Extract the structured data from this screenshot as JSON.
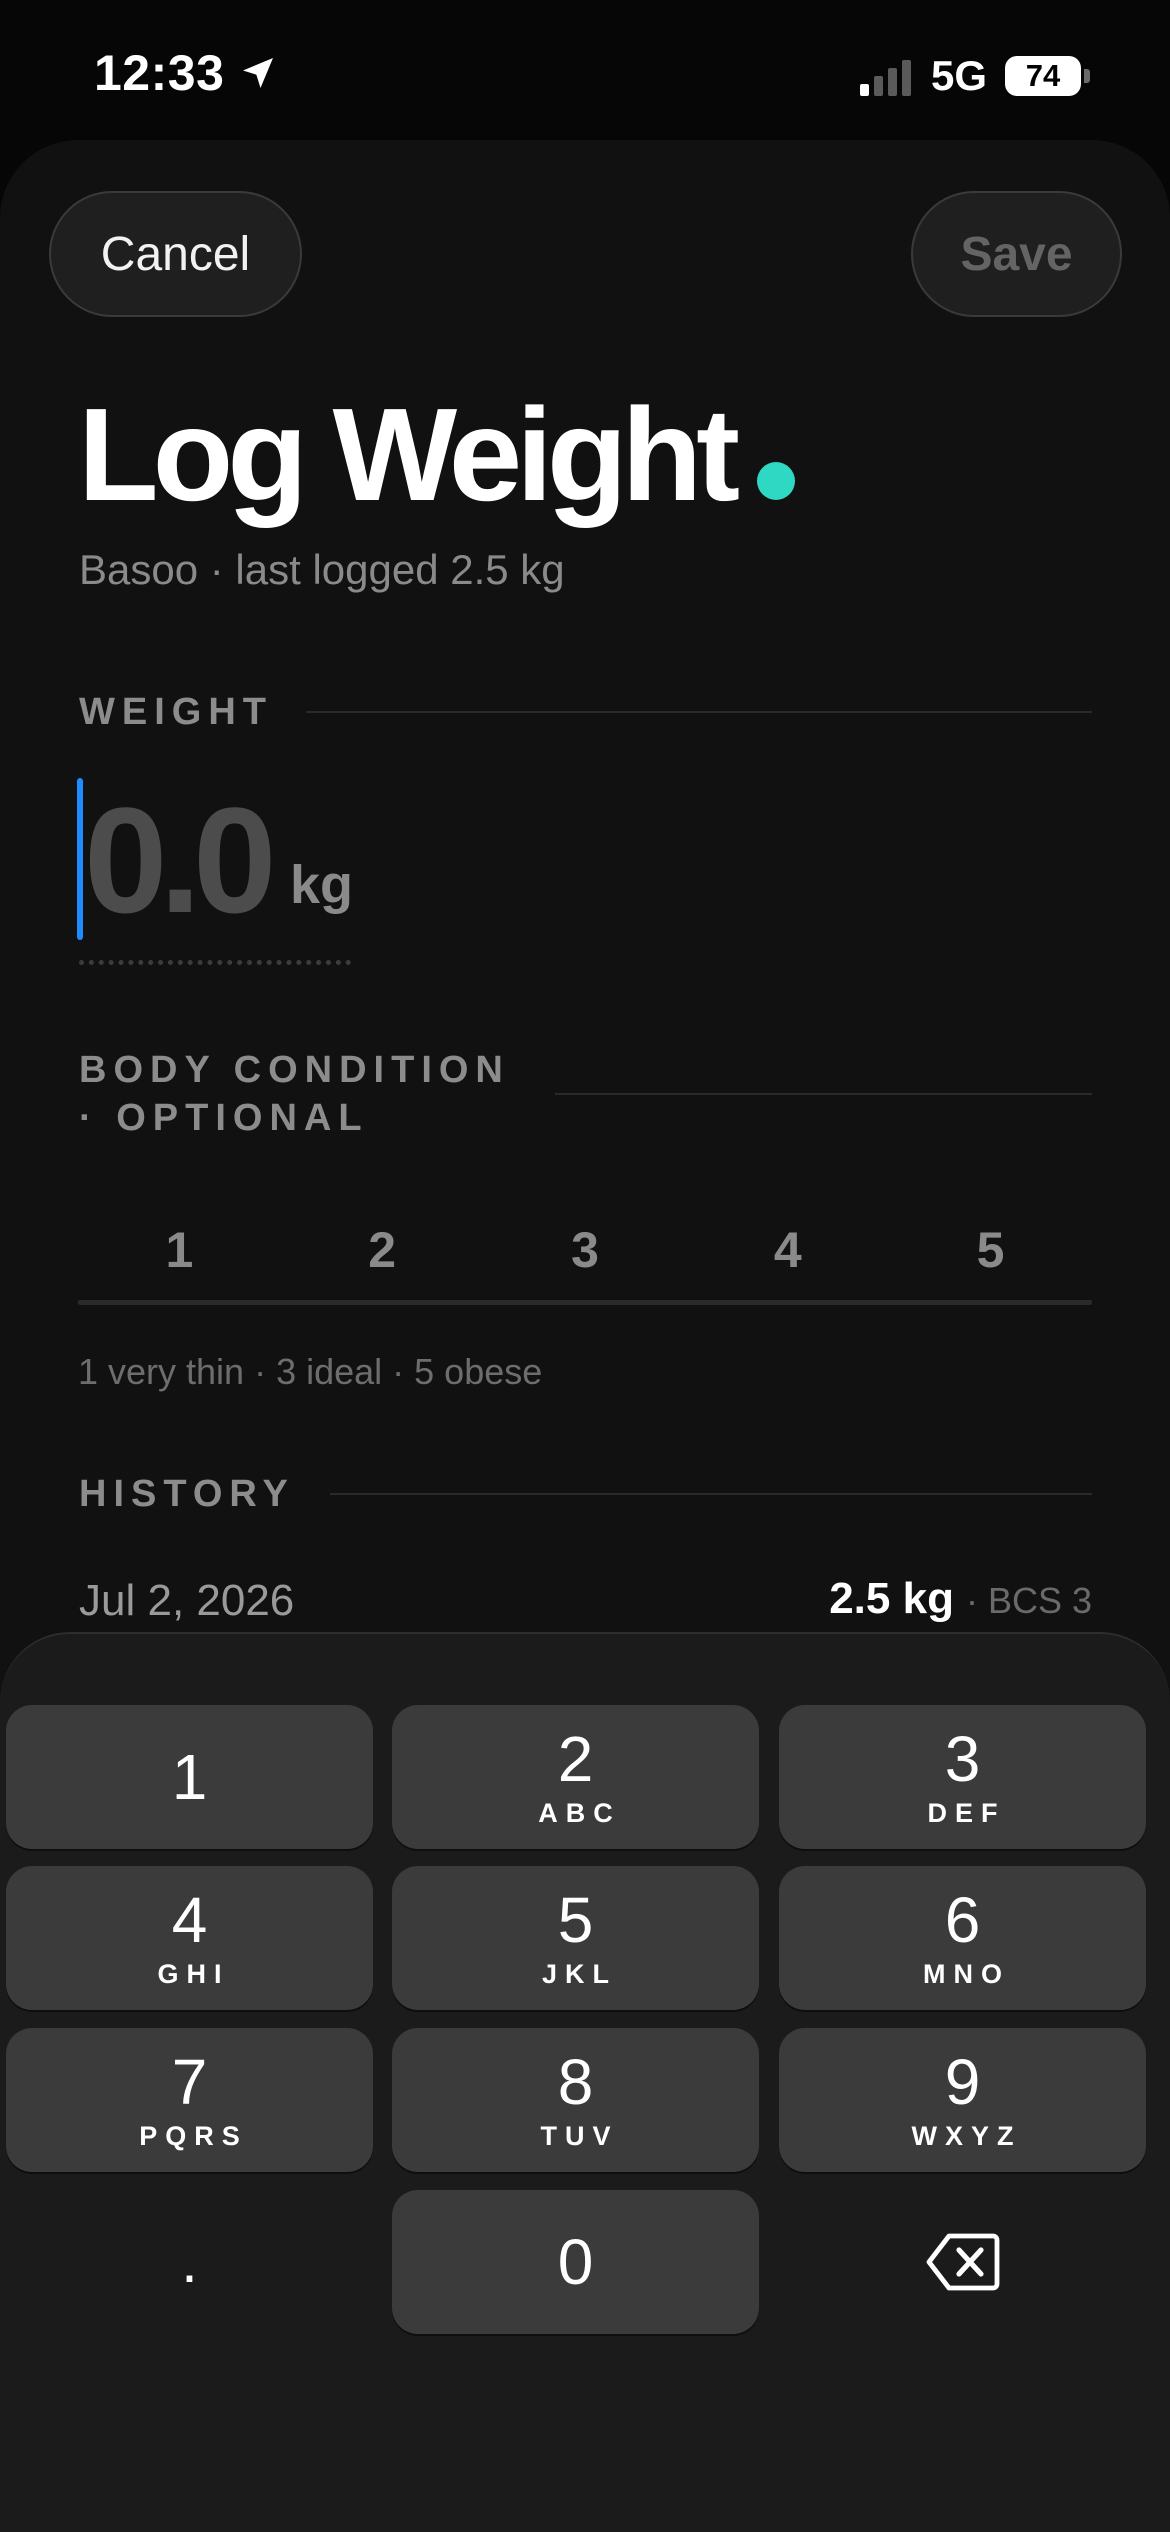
{
  "status_bar": {
    "time": "12:33",
    "network": "5G",
    "battery": "74"
  },
  "header": {
    "cancel_label": "Cancel",
    "save_label": "Save"
  },
  "title": "Log Weight",
  "subtitle": "Basoo · last logged 2.5 kg",
  "weight": {
    "label": "WEIGHT",
    "value": "0.0",
    "unit": "kg"
  },
  "body_condition": {
    "label_line1": "BODY CONDITION",
    "label_line2": "· OPTIONAL",
    "options": [
      "1",
      "2",
      "3",
      "4",
      "5"
    ],
    "hint": "1 very thin · 3 ideal · 5 obese"
  },
  "history": {
    "label": "HISTORY",
    "entries": [
      {
        "date": "Jul 2, 2026",
        "weight": "2.5 kg",
        "bcs": "· BCS 3"
      }
    ]
  },
  "keypad": {
    "keys": [
      {
        "num": "1",
        "letters": ""
      },
      {
        "num": "2",
        "letters": "ABC"
      },
      {
        "num": "3",
        "letters": "DEF"
      },
      {
        "num": "4",
        "letters": "GHI"
      },
      {
        "num": "5",
        "letters": "JKL"
      },
      {
        "num": "6",
        "letters": "MNO"
      },
      {
        "num": "7",
        "letters": "PQRS"
      },
      {
        "num": "8",
        "letters": "TUV"
      },
      {
        "num": "9",
        "letters": "WXYZ"
      },
      {
        "num": ".",
        "letters": ""
      },
      {
        "num": "0",
        "letters": ""
      }
    ]
  },
  "colors": {
    "accent_dot": "#2ed8c3",
    "cursor": "#1e8cff",
    "background": "#111111"
  },
  "icons": {
    "location": "location-arrow-icon",
    "delete": "backspace-icon"
  }
}
